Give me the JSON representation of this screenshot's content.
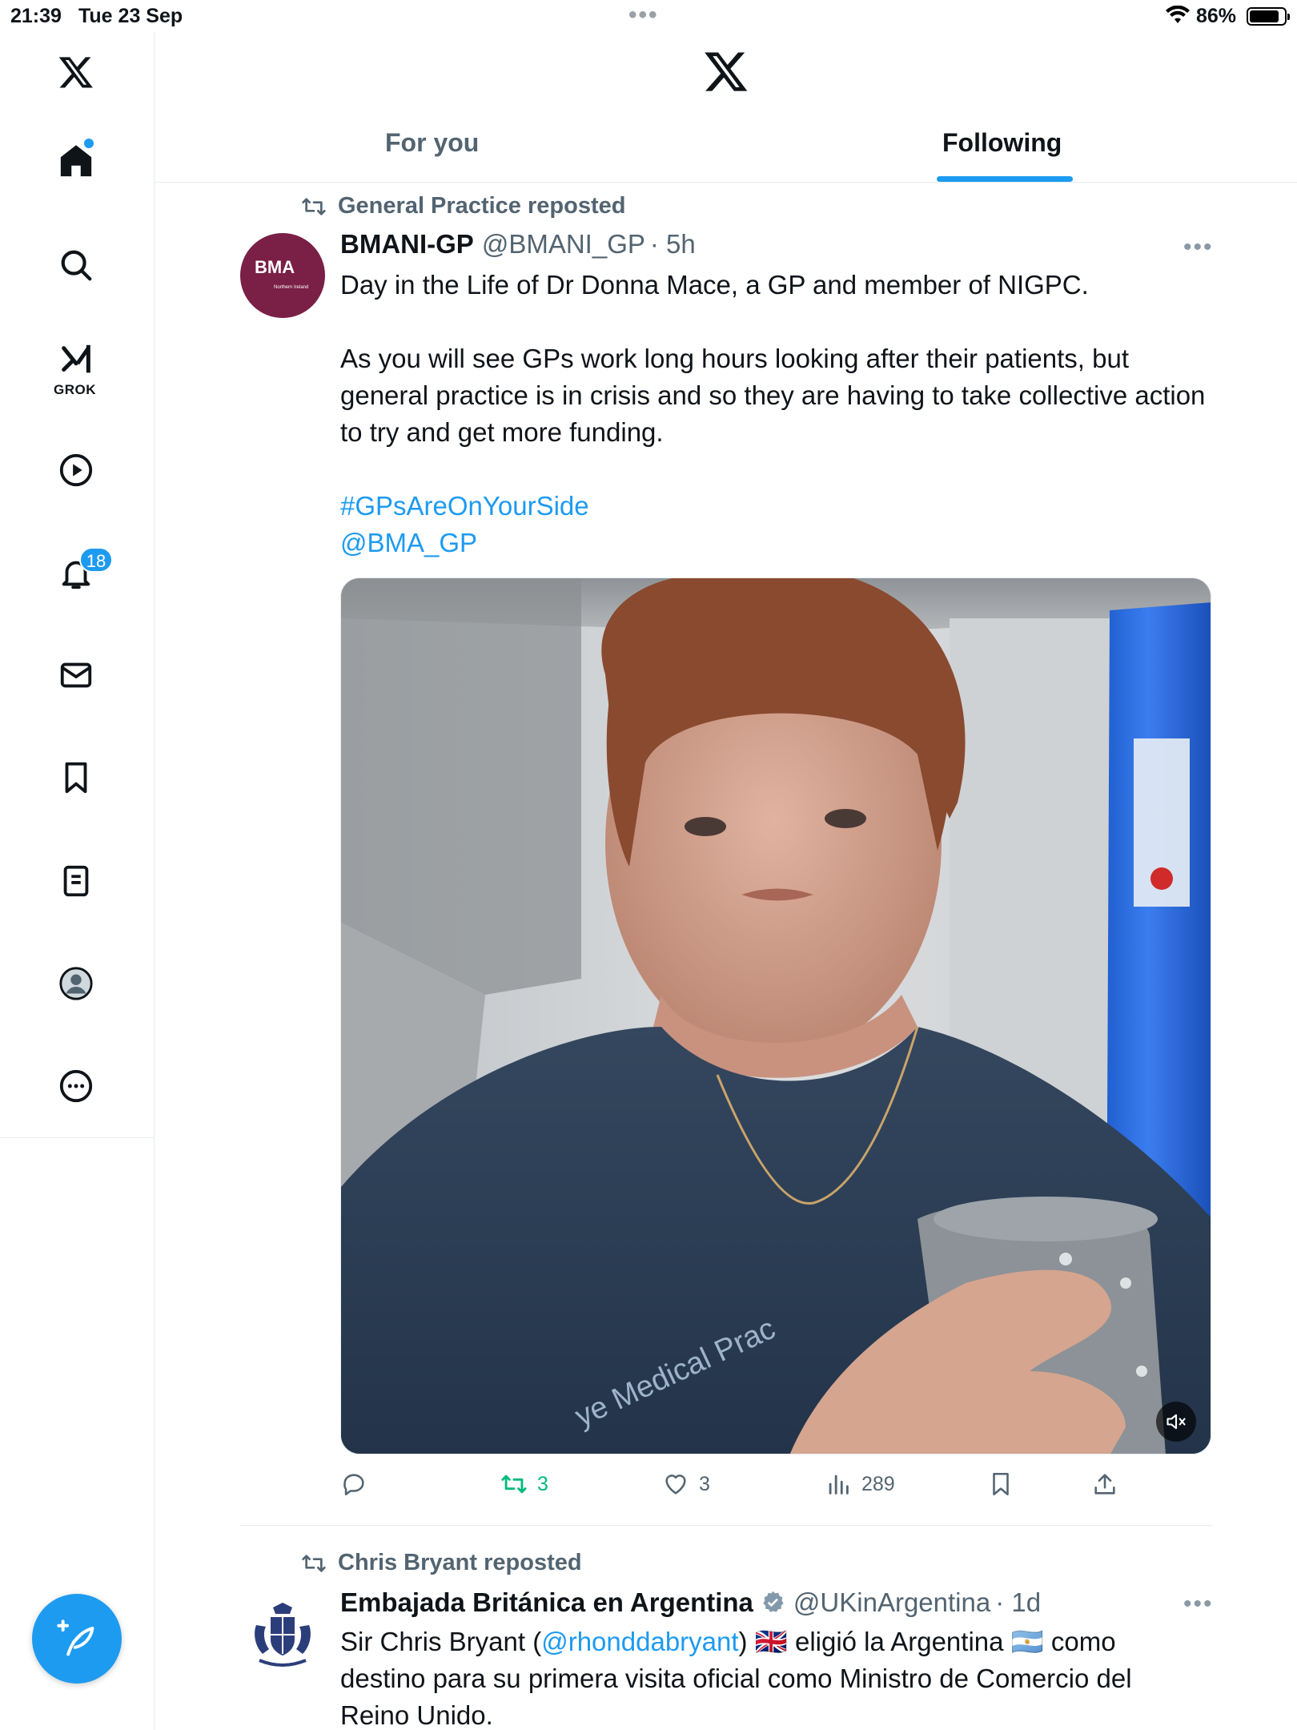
{
  "status_bar": {
    "time": "21:39",
    "date": "Tue 23 Sep",
    "battery_percent": "86%",
    "battery_level": 0.86
  },
  "sidebar": {
    "items": [
      {
        "name": "home",
        "icon": "home-icon"
      },
      {
        "name": "search",
        "icon": "search-icon"
      },
      {
        "name": "grok",
        "icon": "grok-icon",
        "label": "GROK"
      },
      {
        "name": "videos",
        "icon": "play-icon"
      },
      {
        "name": "notifications",
        "icon": "bell-icon",
        "badge": "18"
      },
      {
        "name": "messages",
        "icon": "mail-icon"
      },
      {
        "name": "bookmarks",
        "icon": "bookmark-icon"
      },
      {
        "name": "lists",
        "icon": "list-icon"
      },
      {
        "name": "profile",
        "icon": "profile-icon"
      },
      {
        "name": "more",
        "icon": "more-icon"
      }
    ]
  },
  "header": {
    "tabs": [
      {
        "label": "For you",
        "active": false
      },
      {
        "label": "Following",
        "active": true
      }
    ]
  },
  "tweets": [
    {
      "repost_label": "General Practice reposted",
      "avatar_text": "BMA",
      "avatar_sub": "Northern Ireland",
      "author_name": "BMANI-GP",
      "handle": "@BMANI_GP",
      "time": "· 5h",
      "text_line1": "Day in the Life of Dr Donna Mace, a GP and member of NIGPC.",
      "text_para2": "As you will see GPs work long hours looking after their patients, but general practice is in crisis and so they are having to take collective action to try and get more funding.",
      "hashtag": "#GPsAreOnYourSide",
      "mention": "@BMA_GP",
      "media_text": "ye Medical Prac",
      "stats": {
        "replies": "",
        "reposts": "3",
        "likes": "3",
        "views": "289"
      }
    },
    {
      "repost_label": "Chris Bryant reposted",
      "author_name": "Embajada Británica en Argentina",
      "verified": true,
      "handle": "@UKinArgentina",
      "time": "· 1d",
      "text_a": "Sir Chris Bryant (",
      "text_mention": "@rhonddabryant",
      "text_b": ") 🇬🇧 eligió la Argentina 🇦🇷 como",
      "text_line2": "destino para su primera visita oficial como Ministro de Comercio del",
      "text_line3": "Reino Unido."
    }
  ],
  "colors": {
    "accent": "#1d9bf0",
    "repost_green": "#00ba7c",
    "muted_text": "#536471",
    "bma_maroon": "#7a1f45"
  }
}
